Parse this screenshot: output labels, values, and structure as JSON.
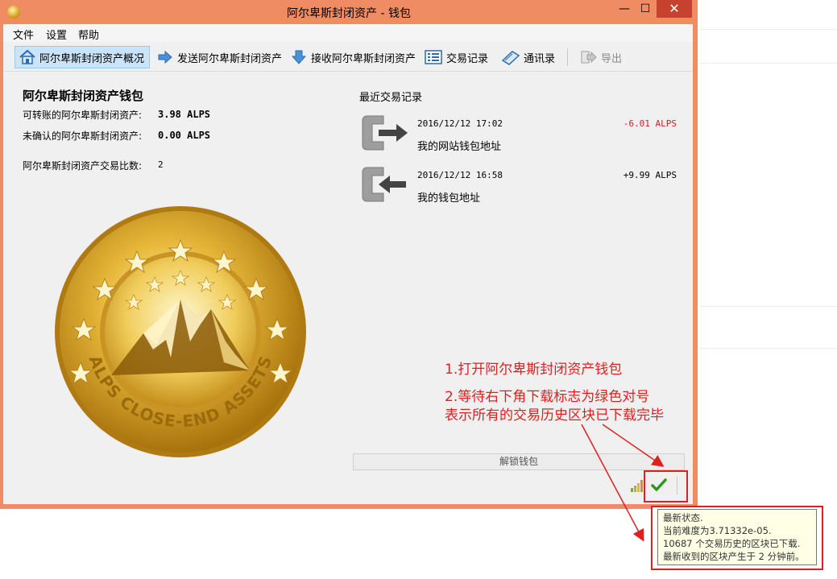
{
  "window": {
    "title": "阿尔卑斯封闭资产 - 钱包",
    "minimize": "—",
    "maximize": "☐",
    "close": "✕"
  },
  "menu": {
    "file": "文件",
    "settings": "设置",
    "help": "帮助"
  },
  "toolbar": {
    "overview": "阿尔卑斯封闭资产概况",
    "send": "发送阿尔卑斯封闭资产",
    "receive": "接收阿尔卑斯封闭资产",
    "transactions": "交易记录",
    "addressbook": "通讯录",
    "export": "导出"
  },
  "overview": {
    "title": "阿尔卑斯封闭资产钱包",
    "balance_label": "可转账的阿尔卑斯封闭资产:",
    "balance_value": "3.98 ALPS",
    "unconfirmed_label": "未确认的阿尔卑斯封闭资产:",
    "unconfirmed_value": "0.00 ALPS",
    "txcount_label": "阿尔卑斯封闭资产交易比数:",
    "txcount_value": "2",
    "coin_text": "ALPS CLOSE-END ASSETS"
  },
  "recent": {
    "title": "最近交易记录",
    "transactions": [
      {
        "date": "2016/12/12 17:02",
        "amount": "-6.01 ALPS",
        "label": "我的网站钱包地址",
        "amount_color": "#d02020",
        "direction": "out"
      },
      {
        "date": "2016/12/12 16:58",
        "amount": "+9.99 ALPS",
        "label": "我的钱包地址",
        "amount_color": "#000000",
        "direction": "in"
      }
    ]
  },
  "unlock_button": "解锁钱包",
  "annotations": {
    "step1": "1.打开阿尔卑斯封闭资产钱包",
    "step2_line1": "2.等待右下角下载标志为绿色对号",
    "step2_line2": "表示所有的交易历史区块已下载完毕"
  },
  "tooltip": {
    "line1": "最新状态.",
    "line2": "当前难度为3.71332e-05.",
    "line3": "10687 个交易历史的区块已下载.",
    "line4": "最新收到的区块产生于 2 分钟前。"
  },
  "colors": {
    "accent": "#f08c63",
    "annotation": "#e02020",
    "check": "#2a9a1e"
  }
}
